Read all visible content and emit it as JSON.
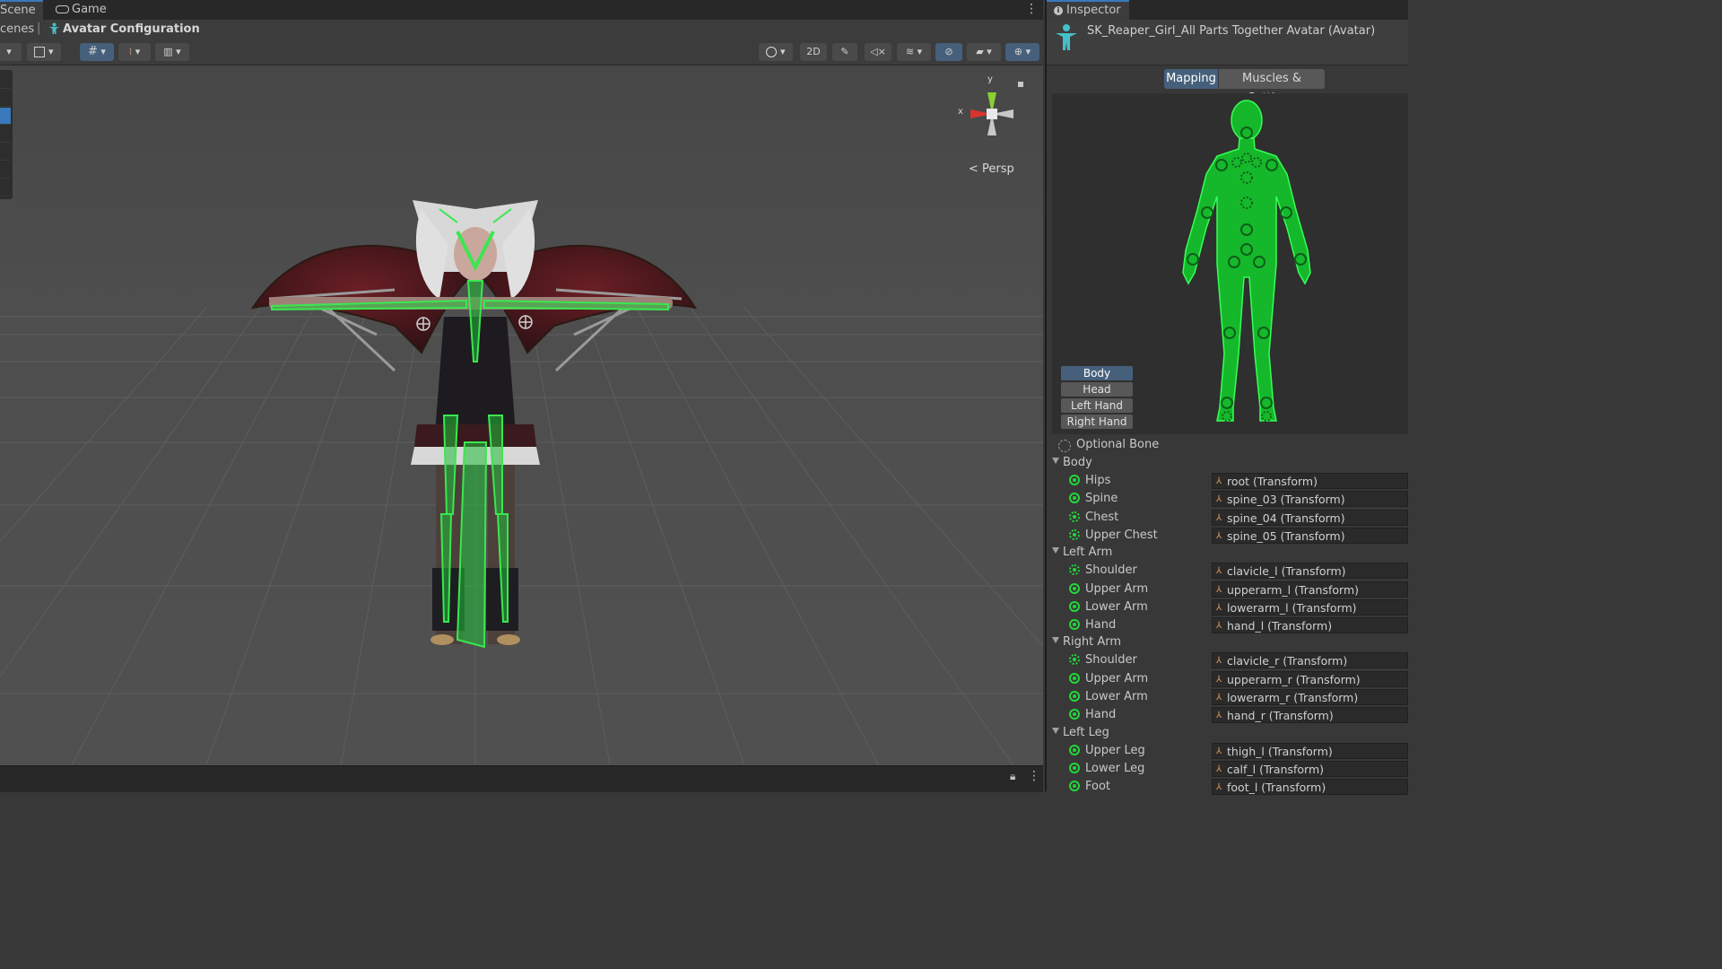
{
  "scene": {
    "tabs": [
      {
        "label": "Scene"
      },
      {
        "label": "Game"
      }
    ],
    "breadcrumb": {
      "parent": "cenes",
      "current": "Avatar Configuration"
    },
    "toolbar": {
      "mode_2d": "2D"
    },
    "gizmo": {
      "y": "y",
      "x": "x",
      "persp": "Persp"
    }
  },
  "inspector": {
    "tab_label": "Inspector",
    "title": "SK_Reaper_Girl_All Parts Together Avatar (Avatar)",
    "tabs": [
      {
        "label": "Mapping"
      },
      {
        "label": "Muscles & Settings"
      }
    ],
    "parts": [
      {
        "label": "Body"
      },
      {
        "label": "Head"
      },
      {
        "label": "Left Hand"
      },
      {
        "label": "Right Hand"
      }
    ],
    "optional_bone": "Optional Bone",
    "groups": [
      {
        "label": "Body",
        "bones": [
          {
            "name": "Hips",
            "value": "root (Transform)",
            "optional": false
          },
          {
            "name": "Spine",
            "value": "spine_03 (Transform)",
            "optional": false
          },
          {
            "name": "Chest",
            "value": "spine_04 (Transform)",
            "optional": true
          },
          {
            "name": "Upper Chest",
            "value": "spine_05 (Transform)",
            "optional": true
          }
        ]
      },
      {
        "label": "Left Arm",
        "bones": [
          {
            "name": "Shoulder",
            "value": "clavicle_l (Transform)",
            "optional": true
          },
          {
            "name": "Upper Arm",
            "value": "upperarm_l (Transform)",
            "optional": false
          },
          {
            "name": "Lower Arm",
            "value": "lowerarm_l (Transform)",
            "optional": false
          },
          {
            "name": "Hand",
            "value": "hand_l (Transform)",
            "optional": false
          }
        ]
      },
      {
        "label": "Right Arm",
        "bones": [
          {
            "name": "Shoulder",
            "value": "clavicle_r (Transform)",
            "optional": true
          },
          {
            "name": "Upper Arm",
            "value": "upperarm_r (Transform)",
            "optional": false
          },
          {
            "name": "Lower Arm",
            "value": "lowerarm_r (Transform)",
            "optional": false
          },
          {
            "name": "Hand",
            "value": "hand_r (Transform)",
            "optional": false
          }
        ]
      },
      {
        "label": "Left Leg",
        "bones": [
          {
            "name": "Upper Leg",
            "value": "thigh_l (Transform)",
            "optional": false
          },
          {
            "name": "Lower Leg",
            "value": "calf_l (Transform)",
            "optional": false
          },
          {
            "name": "Foot",
            "value": "foot_l (Transform)",
            "optional": false
          }
        ]
      }
    ]
  },
  "colors": {
    "accent": "#3a79bb",
    "bone_green": "#22d83a",
    "selected_tab": "#46607c"
  }
}
